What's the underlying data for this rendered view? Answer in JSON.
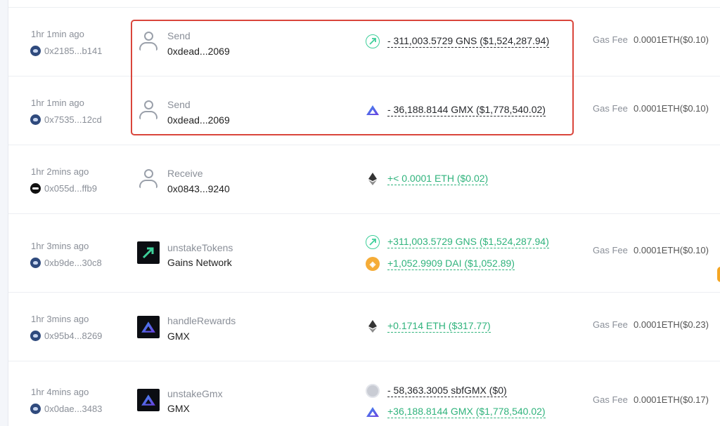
{
  "rows": [
    {
      "time": "1hr 1min ago",
      "hash": "0x2185...b141",
      "action": "Send",
      "address": "0xdead...2069",
      "tokens": [
        {
          "icon": "gns-icon",
          "amount": "- 311,003.5729 GNS ($1,524,287.94)",
          "direction": "out"
        }
      ],
      "gas_label": "Gas Fee",
      "gas_value": "0.0001ETH($0.10)"
    },
    {
      "time": "1hr 1min ago",
      "hash": "0x7535...12cd",
      "action": "Send",
      "address": "0xdead...2069",
      "tokens": [
        {
          "icon": "gmx-icon",
          "amount": "- 36,188.8144 GMX ($1,778,540.02)",
          "direction": "out"
        }
      ],
      "gas_label": "Gas Fee",
      "gas_value": "0.0001ETH($0.10)"
    },
    {
      "time": "1hr 2mins ago",
      "hash": "0x055d...ffb9",
      "action": "Receive",
      "address": "0x0843...9240",
      "tokens": [
        {
          "icon": "eth-icon",
          "amount": "+< 0.0001 ETH ($0.02)",
          "direction": "in"
        }
      ],
      "gas_label": "",
      "gas_value": ""
    },
    {
      "time": "1hr 3mins ago",
      "hash": "0xb9de...30c8",
      "action": "unstakeTokens",
      "address": "Gains Network",
      "tokens": [
        {
          "icon": "gns-icon",
          "amount": "+311,003.5729 GNS ($1,524,287.94)",
          "direction": "in"
        },
        {
          "icon": "dai-icon",
          "amount": "+1,052.9909 DAI ($1,052.89)",
          "direction": "in"
        }
      ],
      "gas_label": "Gas Fee",
      "gas_value": "0.0001ETH($0.10)"
    },
    {
      "time": "1hr 3mins ago",
      "hash": "0x95b4...8269",
      "action": "handleRewards",
      "address": "GMX",
      "tokens": [
        {
          "icon": "eth-icon",
          "amount": "+0.1714 ETH ($317.77)",
          "direction": "in"
        }
      ],
      "gas_label": "Gas Fee",
      "gas_value": "0.0001ETH($0.23)"
    },
    {
      "time": "1hr 4mins ago",
      "hash": "0x0dae...3483",
      "action": "unstakeGmx",
      "address": "GMX",
      "tokens": [
        {
          "icon": "sbfgmx-icon",
          "amount": "- 58,363.3005 sbfGMX ($0)",
          "direction": "out"
        },
        {
          "icon": "gmx-icon",
          "amount": "+36,188.8144 GMX ($1,778,540.02)",
          "direction": "in"
        }
      ],
      "gas_label": "Gas Fee",
      "gas_value": "0.0001ETH($0.17)"
    }
  ],
  "colors": {
    "highlight": "#d9453b",
    "incoming": "#2fb37c",
    "outgoing": "#26282c"
  }
}
